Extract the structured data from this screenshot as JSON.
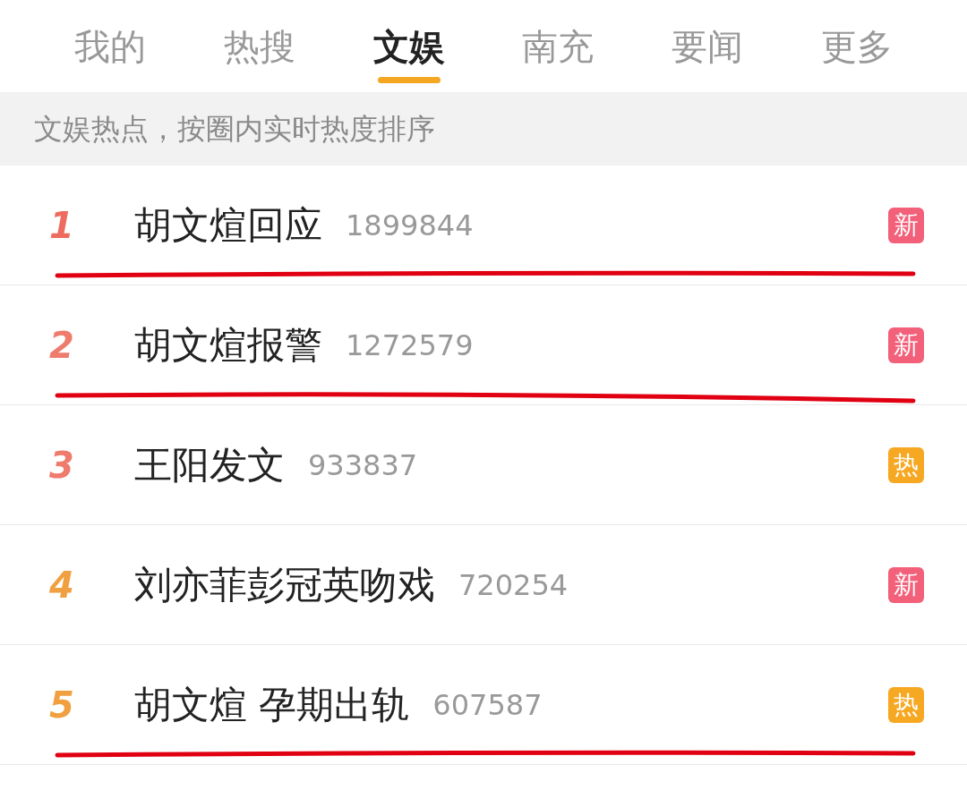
{
  "tabs": [
    {
      "label": "我的",
      "selected": false
    },
    {
      "label": "热搜",
      "selected": false
    },
    {
      "label": "文娱",
      "selected": true
    },
    {
      "label": "南充",
      "selected": false
    },
    {
      "label": "要闻",
      "selected": false
    },
    {
      "label": "更多",
      "selected": false
    }
  ],
  "banner": "文娱热点，按圈内实时热度排序",
  "rows": [
    {
      "rank": "1",
      "color": "#ee6b5f",
      "title": "胡文煊回应",
      "count": "1899844",
      "badge": {
        "text": "新",
        "color": "#f2607a"
      },
      "underlined": true
    },
    {
      "rank": "2",
      "color": "#ee7b6c",
      "title": "胡文煊报警",
      "count": "1272579",
      "badge": {
        "text": "新",
        "color": "#f2607a"
      },
      "underlined": true
    },
    {
      "rank": "3",
      "color": "#ee7b6c",
      "title": "王阳发文",
      "count": "933837",
      "badge": {
        "text": "热",
        "color": "#f7a823"
      },
      "underlined": false
    },
    {
      "rank": "4",
      "color": "#f0a040",
      "title": "刘亦菲彭冠英吻戏",
      "count": "720254",
      "badge": {
        "text": "新",
        "color": "#f2607a"
      },
      "underlined": false
    },
    {
      "rank": "5",
      "color": "#f0a040",
      "title": "胡文煊 孕期出轨",
      "count": "607587",
      "badge": {
        "text": "热",
        "color": "#f7a823"
      },
      "underlined": true
    }
  ]
}
